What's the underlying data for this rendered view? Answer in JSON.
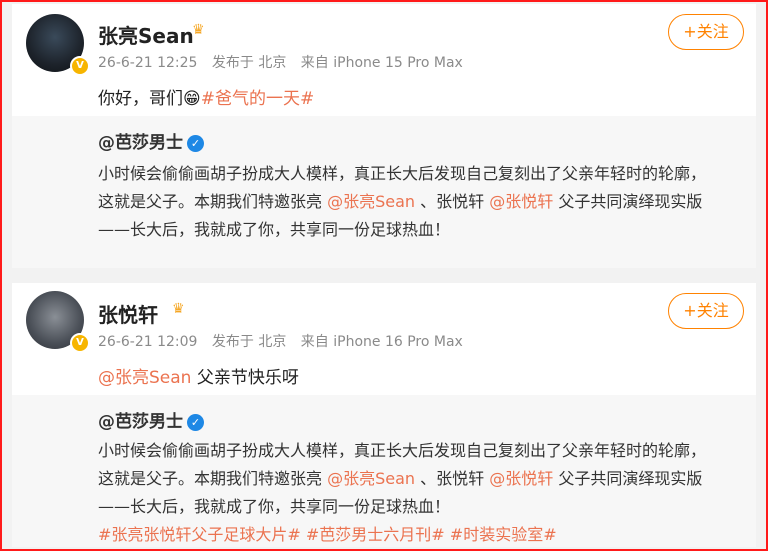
{
  "posts": [
    {
      "author": "张亮Sean",
      "time": "26-6-21 12:25",
      "location": "发布于 北京",
      "device": "来自 iPhone 15 Pro Max",
      "follow_label": "+关注",
      "text_prefix": "你好，哥们",
      "emoji": "😁",
      "text_hashtag": "#爸气的一天#",
      "repost": {
        "author": "@芭莎男士",
        "line1": "小时候会偷偷画胡子扮成大人模样，真正长大后发现自己复刻出了父亲年轻时的轮廓，",
        "line2_a": "这就是父子。本期我们特邀张亮",
        "line2_m1": "@张亮Sean",
        "line2_b": "、张悦轩",
        "line2_m2": "@张悦轩",
        "line2_c": "父子共同演绎现实版",
        "line3": "——长大后，我就成了你，共享同一份足球热血！"
      }
    },
    {
      "author": "张悦轩",
      "time": "26-6-21 12:09",
      "location": "发布于 北京",
      "device": "来自 iPhone 16 Pro Max",
      "follow_label": "+关注",
      "text_mention": "@张亮Sean",
      "text_rest": "父亲节快乐呀",
      "repost": {
        "author": "@芭莎男士",
        "line1": "小时候会偷偷画胡子扮成大人模样，真正长大后发现自己复刻出了父亲年轻时的轮廓，",
        "line2_a": "这就是父子。本期我们特邀张亮",
        "line2_m1": "@张亮Sean",
        "line2_b": "、张悦轩",
        "line2_m2": "@张悦轩",
        "line2_c": "父子共同演绎现实版",
        "line3": "——长大后，我就成了你，共享同一份足球热血！",
        "hashtags": "#张亮张悦轩父子足球大片# #芭莎男士六月刊# #时装实验室#"
      }
    }
  ],
  "colors": {
    "accent": "#ff8200",
    "link": "#eb7350",
    "frame": "#ff1a1a",
    "verified": "#1e88e5"
  }
}
